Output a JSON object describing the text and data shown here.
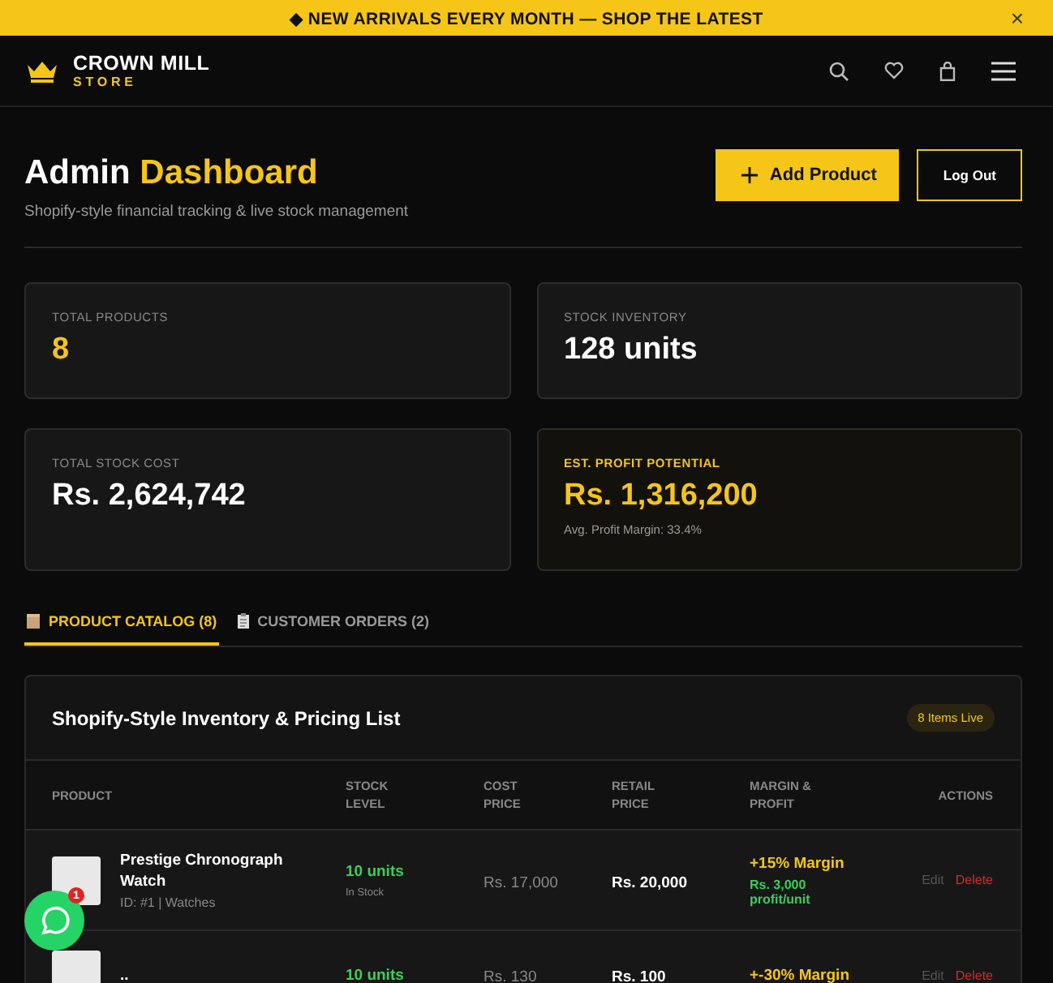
{
  "announcement": {
    "text": "◆ NEW ARRIVALS EVERY MONTH — SHOP THE LATEST",
    "close": "×"
  },
  "header": {
    "brand": "CROWN MILL",
    "brand_sub": "STORE"
  },
  "page": {
    "title": "Admin",
    "title_accent": "Dashboard",
    "subtitle": "Shopify-style financial tracking & live stock management",
    "add_button": "Add Product",
    "logout_button": "Log Out"
  },
  "stats": [
    {
      "label": "TOTAL PRODUCTS",
      "value": "8",
      "highlight": false,
      "value_accent": true
    },
    {
      "label": "STOCK INVENTORY",
      "value": "128 units",
      "highlight": false,
      "value_accent": false
    },
    {
      "label": "TOTAL STOCK COST",
      "value": "Rs. 2,624,742",
      "highlight": false,
      "value_accent": false
    },
    {
      "label": "EST. PROFIT POTENTIAL",
      "value": "Rs. 1,316,200",
      "note": "Avg. Profit Margin: 33.4%",
      "highlight": true,
      "value_accent": true
    }
  ],
  "tabs": [
    {
      "label": "PRODUCT CATALOG (8)",
      "selected": true
    },
    {
      "label": "CUSTOMER ORDERS (2)",
      "selected": false
    }
  ],
  "table": {
    "title": "Shopify-Style Inventory & Pricing List",
    "badge": "8 Items Live",
    "columns": [
      "PRODUCT",
      "STOCK LEVEL",
      "COST PRICE",
      "RETAIL PRICE",
      "MARGIN & PROFIT",
      "ACTIONS"
    ],
    "rows": [
      {
        "name": "Prestige Chronograph Watch",
        "meta": "ID: #1 | Watches",
        "stock": "10 units",
        "stock_status": "In Stock",
        "cost": "Rs. 17,000",
        "retail": "Rs. 20,000",
        "margin": "+15% Margin",
        "profit": "Rs. 3,000 profit/unit",
        "edit": "Edit",
        "delete": "Delete"
      },
      {
        "name": "..",
        "stock": "10 units",
        "cost": "Rs. 130",
        "retail": "Rs. 100",
        "margin": "+-30% Margin",
        "edit": "Edit",
        "delete": "Delete"
      }
    ]
  },
  "chat": {
    "badge": "1"
  }
}
